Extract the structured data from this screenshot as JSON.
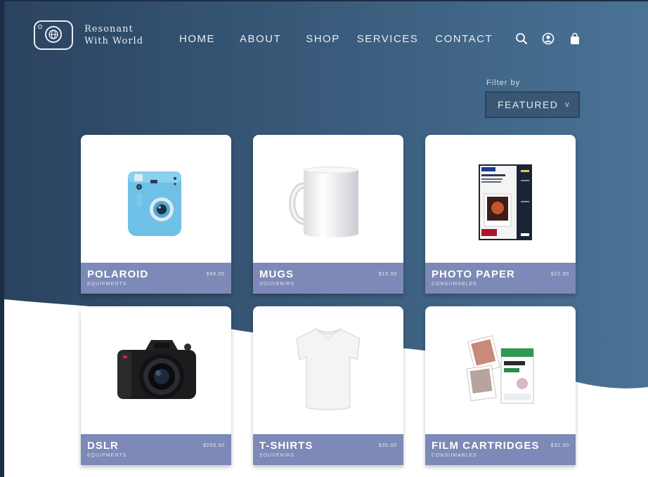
{
  "brand": {
    "line1": "Resonant",
    "line2": "With World"
  },
  "nav": [
    {
      "label": "HOME"
    },
    {
      "label": "ABOUT"
    },
    {
      "label": "SHOP"
    },
    {
      "label": "SERVICES"
    },
    {
      "label": "CONTACT"
    }
  ],
  "header_icons": [
    "search-icon",
    "user-icon",
    "shopping-bag-icon"
  ],
  "filter": {
    "label": "Filter by",
    "selected": "FEATURED",
    "caret": "v"
  },
  "products": [
    {
      "title": "POLAROID",
      "category": "EQUIPMENTS",
      "price": "$59.00"
    },
    {
      "title": "MUGS",
      "category": "SOUVENIRS",
      "price": "$15.00"
    },
    {
      "title": "PHOTO PAPER",
      "category": "CONSUMABLES",
      "price": "$22.00"
    },
    {
      "title": "DSLR",
      "category": "EQUIPMENTS",
      "price": "$250.00"
    },
    {
      "title": "T-SHIRTS",
      "category": "SOUVENIRS",
      "price": "$35.00"
    },
    {
      "title": "FILM CARTRIDGES",
      "category": "CONSUMABLES",
      "price": "$32.00"
    }
  ],
  "colors": {
    "hero_dark": "#2d4763",
    "hero_light": "#456f93",
    "card_bar": "#7d89b6",
    "background": "#ffffff"
  }
}
